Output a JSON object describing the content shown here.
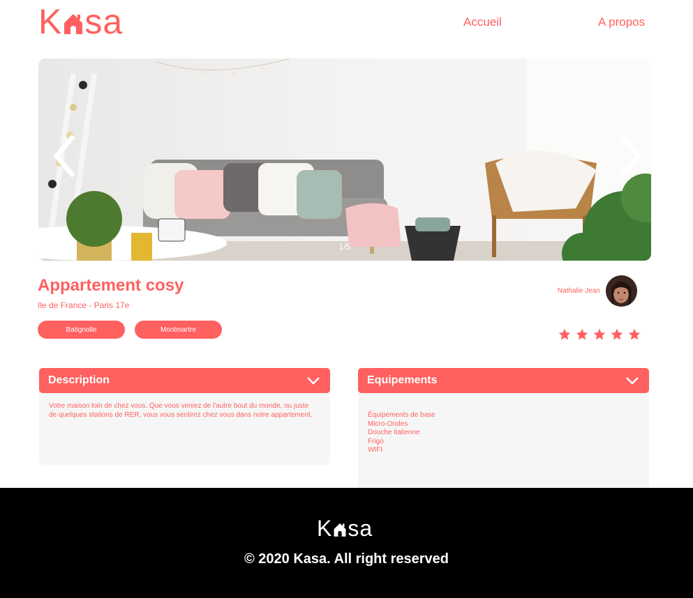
{
  "header": {
    "logo_text_left": "K",
    "logo_text_right": "sa",
    "nav": {
      "home": "Accueil",
      "about": "A propos"
    }
  },
  "carousel": {
    "counter": "1/5",
    "icons": {
      "prev": "chevron-left-icon",
      "next": "chevron-right-icon"
    }
  },
  "listing": {
    "title": "Appartement cosy",
    "location": "Ile de France - Paris 17e",
    "tags": [
      "Batignolle",
      "Montmartre"
    ],
    "host_name": "Nathalie Jean",
    "rating": 5,
    "rating_max": 5
  },
  "description": {
    "title": "Description",
    "text": "Votre maison loin de chez vous. Que vous veniez de l'autre bout du monde, ou juste de quelques stations de RER, vous vous sentirez chez vous dans notre appartement."
  },
  "equipments": {
    "title": "Equipements",
    "items": [
      "Équipements de base",
      "Micro-Ondes",
      "Douche italienne",
      "Frigo",
      "WIFI"
    ]
  },
  "footer": {
    "logo_text_left": "K",
    "logo_text_right": "sa",
    "copyright": "© 2020 Kasa. All right reserved"
  },
  "colors": {
    "accent": "#FF6060",
    "panel": "#F6F6F6",
    "footer_bg": "#000000"
  }
}
